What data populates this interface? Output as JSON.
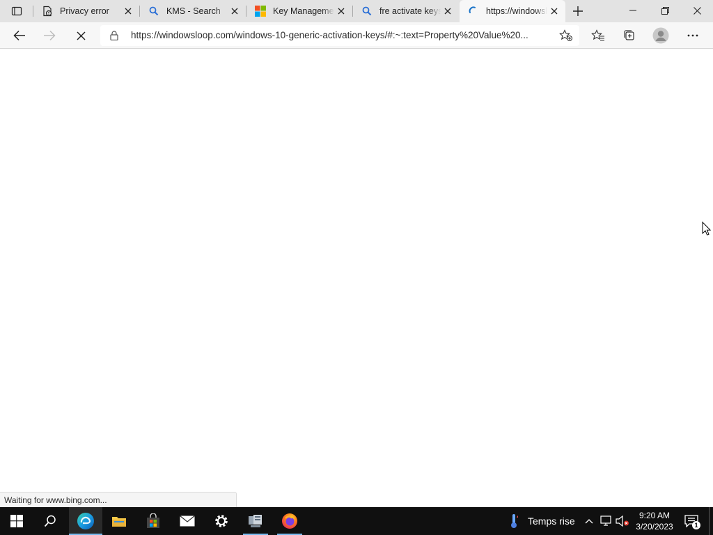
{
  "browser": {
    "tabs": [
      {
        "title": "Privacy error",
        "favicon": "warning-page-icon"
      },
      {
        "title": "KMS - Search",
        "favicon": "search-icon"
      },
      {
        "title": "Key Management",
        "favicon": "microsoft-logo-icon"
      },
      {
        "title": "fre activate keys",
        "favicon": "search-icon"
      },
      {
        "title": "https://windowsloop.com",
        "favicon": "loading-spinner-icon",
        "active": true
      }
    ],
    "address_url": "https://windowsloop.com/windows-10-generic-activation-keys/#:~:text=Property%20Value%20...",
    "status_text": "Waiting for www.bing.com..."
  },
  "taskbar": {
    "weather_text": "Temps rise",
    "time": "9:20 AM",
    "date": "3/20/2023",
    "notification_count": "1",
    "accent_color": "#76b9ed"
  }
}
